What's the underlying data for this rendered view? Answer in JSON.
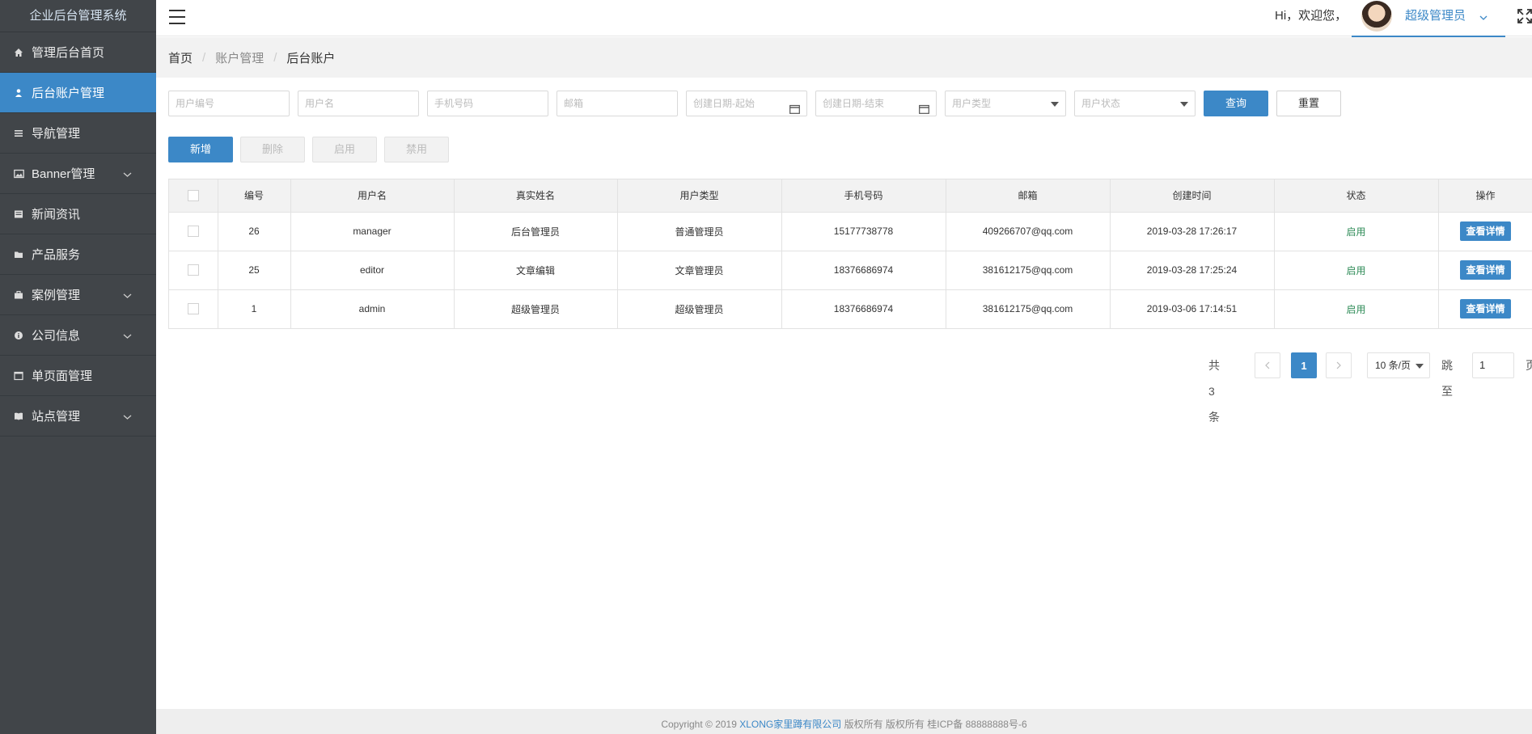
{
  "app": {
    "title": "企业后台管理系统"
  },
  "sidebar": {
    "items": [
      {
        "label": "管理后台首页",
        "icon": "home-icon",
        "active": false,
        "expandable": false
      },
      {
        "label": "后台账户管理",
        "icon": "user-icon",
        "active": true,
        "expandable": false
      },
      {
        "label": "导航管理",
        "icon": "list-icon",
        "active": false,
        "expandable": false
      },
      {
        "label": "Banner管理",
        "icon": "image-icon",
        "active": false,
        "expandable": true
      },
      {
        "label": "新闻资讯",
        "icon": "news-icon",
        "active": false,
        "expandable": false
      },
      {
        "label": "产品服务",
        "icon": "folder-icon",
        "active": false,
        "expandable": false
      },
      {
        "label": "案例管理",
        "icon": "briefcase-icon",
        "active": false,
        "expandable": true
      },
      {
        "label": "公司信息",
        "icon": "info-icon",
        "active": false,
        "expandable": true
      },
      {
        "label": "单页面管理",
        "icon": "page-icon",
        "active": false,
        "expandable": false
      },
      {
        "label": "站点管理",
        "icon": "book-icon",
        "active": false,
        "expandable": true
      }
    ]
  },
  "header": {
    "welcome": "Hi，欢迎您，",
    "username": "超级管理员"
  },
  "breadcrumb": {
    "home": "首页",
    "section": "账户管理",
    "current": "后台账户"
  },
  "filters": {
    "id_placeholder": "用户编号",
    "username_placeholder": "用户名",
    "phone_placeholder": "手机号码",
    "email_placeholder": "邮箱",
    "date_start_placeholder": "创建日期-起始",
    "date_end_placeholder": "创建日期-结束",
    "user_type_placeholder": "用户类型",
    "user_status_placeholder": "用户状态",
    "query_label": "查询",
    "reset_label": "重置"
  },
  "actions": {
    "add": "新增",
    "delete": "删除",
    "enable": "启用",
    "disable": "禁用"
  },
  "table": {
    "headers": [
      "编号",
      "用户名",
      "真实姓名",
      "用户类型",
      "手机号码",
      "邮箱",
      "创建时间",
      "状态",
      "操作"
    ],
    "detail_label": "查看详情",
    "rows": [
      {
        "id": "26",
        "username": "manager",
        "realname": "后台管理员",
        "type": "普通管理员",
        "phone": "15177738778",
        "email": "409266707@qq.com",
        "created": "2019-03-28 17:26:17",
        "status": "启用"
      },
      {
        "id": "25",
        "username": "editor",
        "realname": "文章编辑",
        "type": "文章管理员",
        "phone": "18376686974",
        "email": "381612175@qq.com",
        "created": "2019-03-28 17:25:24",
        "status": "启用"
      },
      {
        "id": "1",
        "username": "admin",
        "realname": "超级管理员",
        "type": "超级管理员",
        "phone": "18376686974",
        "email": "381612175@qq.com",
        "created": "2019-03-06 17:14:51",
        "status": "启用"
      }
    ]
  },
  "pagination": {
    "total": "共 3 条",
    "current_page": "1",
    "page_size": "10 条/页",
    "jump_label": "跳至",
    "jump_value": "1",
    "page_suffix": "页"
  },
  "footer": {
    "prefix": "Copyright © 2019 ",
    "company": "XLONG家里蹲有限公司",
    "suffix": " 版权所有 版权所有 桂ICP备 88888888号-6"
  },
  "colors": {
    "accent": "#3c88c7",
    "sidebar_bg": "#414549",
    "status_on": "#2e8b57"
  }
}
